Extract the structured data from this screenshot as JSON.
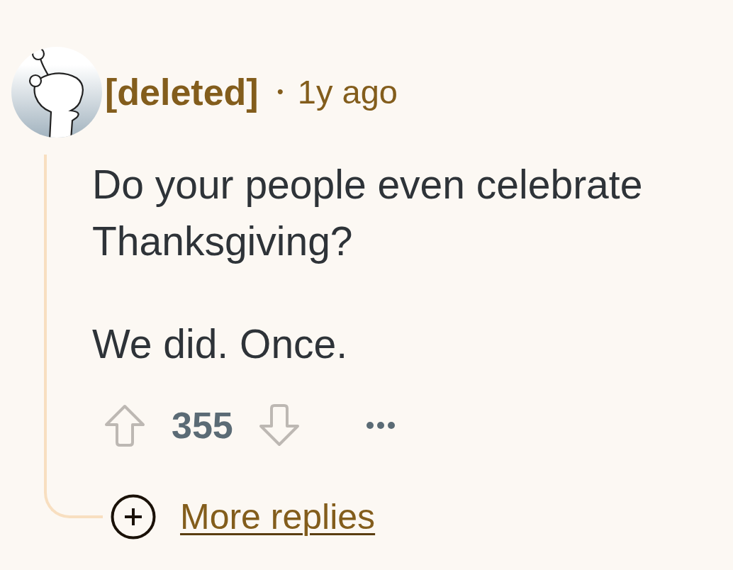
{
  "comment": {
    "author": "[deleted]",
    "separator": "•",
    "age": "1y ago",
    "body": [
      "Do your people even celebrate Thanksgiving?",
      "We did. Once."
    ],
    "score": "355",
    "more_replies": "More replies"
  }
}
